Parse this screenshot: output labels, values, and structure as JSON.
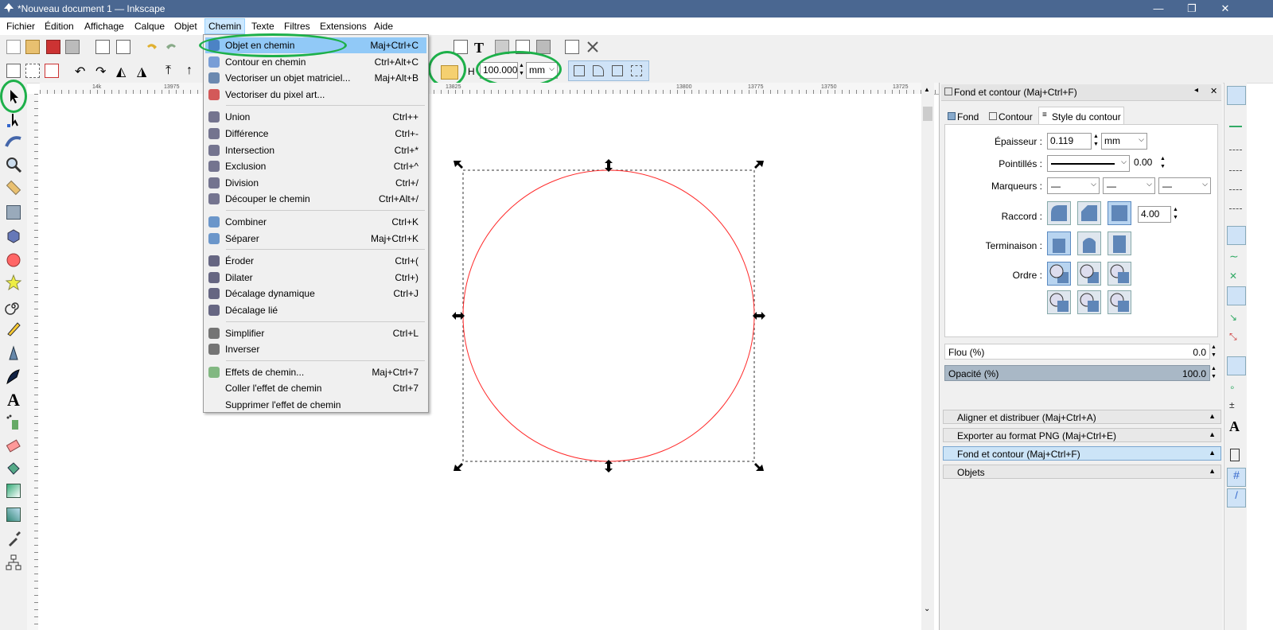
{
  "window": {
    "title": "*Nouveau document 1 — Inkscape",
    "min": "—",
    "max": "❐",
    "close": "✕"
  },
  "menubar": [
    {
      "label": "Fichier"
    },
    {
      "label": "Édition"
    },
    {
      "label": "Affichage"
    },
    {
      "label": "Calque"
    },
    {
      "label": "Objet"
    },
    {
      "label": "Chemin"
    },
    {
      "label": "Texte"
    },
    {
      "label": "Filtres"
    },
    {
      "label": "Extensions"
    },
    {
      "label": "Aide"
    }
  ],
  "toolbar2": {
    "h_label": "H",
    "h_value": "100.000",
    "unit": "mm"
  },
  "ruler": {
    "ticks": [
      "14k",
      "13975",
      "13825",
      "13800",
      "13775",
      "13750",
      "13725"
    ]
  },
  "menu_chemin": {
    "groups": [
      [
        {
          "label": "Objet en chemin",
          "shortcut": "Maj+Ctrl+C",
          "icon": "object-to-path-icon"
        },
        {
          "label": "Contour en chemin",
          "shortcut": "Ctrl+Alt+C",
          "icon": "stroke-to-path-icon"
        },
        {
          "label": "Vectoriser un objet matriciel...",
          "shortcut": "Maj+Alt+B",
          "icon": "trace-bitmap-icon"
        },
        {
          "label": "Vectoriser du pixel art...",
          "shortcut": "",
          "icon": "trace-pixel-art-icon"
        }
      ],
      [
        {
          "label": "Union",
          "shortcut": "Ctrl++",
          "icon": "union-icon"
        },
        {
          "label": "Différence",
          "shortcut": "Ctrl+-",
          "icon": "difference-icon"
        },
        {
          "label": "Intersection",
          "shortcut": "Ctrl+*",
          "icon": "intersection-icon"
        },
        {
          "label": "Exclusion",
          "shortcut": "Ctrl+^",
          "icon": "exclusion-icon"
        },
        {
          "label": "Division",
          "shortcut": "Ctrl+/",
          "icon": "division-icon"
        },
        {
          "label": "Découper le chemin",
          "shortcut": "Ctrl+Alt+/",
          "icon": "cut-path-icon"
        }
      ],
      [
        {
          "label": "Combiner",
          "shortcut": "Ctrl+K",
          "icon": "combine-icon"
        },
        {
          "label": "Séparer",
          "shortcut": "Maj+Ctrl+K",
          "icon": "break-apart-icon"
        }
      ],
      [
        {
          "label": "Éroder",
          "shortcut": "Ctrl+(",
          "icon": "inset-icon"
        },
        {
          "label": "Dilater",
          "shortcut": "Ctrl+)",
          "icon": "outset-icon"
        },
        {
          "label": "Décalage dynamique",
          "shortcut": "Ctrl+J",
          "icon": "dynamic-offset-icon"
        },
        {
          "label": "Décalage lié",
          "shortcut": "",
          "icon": "linked-offset-icon"
        }
      ],
      [
        {
          "label": "Simplifier",
          "shortcut": "Ctrl+L",
          "icon": "simplify-icon"
        },
        {
          "label": "Inverser",
          "shortcut": "",
          "icon": "reverse-icon"
        }
      ],
      [
        {
          "label": "Effets de chemin...",
          "shortcut": "Maj+Ctrl+7",
          "icon": "path-effects-icon"
        },
        {
          "label": "Coller l'effet de chemin",
          "shortcut": "Ctrl+7",
          "icon": ""
        },
        {
          "label": "Supprimer l'effet de chemin",
          "shortcut": "",
          "icon": ""
        }
      ]
    ]
  },
  "panel": {
    "title": "Fond et contour (Maj+Ctrl+F)",
    "tabs": [
      {
        "label": "Fond"
      },
      {
        "label": "Contour"
      },
      {
        "label": "Style du contour"
      }
    ],
    "epaisseur_label": "Épaisseur :",
    "epaisseur_value": "0.119",
    "epaisseur_unit": "mm",
    "pointilles_label": "Pointillés :",
    "pointilles_value": "0.00",
    "marqueurs_label": "Marqueurs :",
    "raccord_label": "Raccord :",
    "raccord_value": "4.00",
    "terminaison_label": "Terminaison :",
    "ordre_label": "Ordre :",
    "flou_label": "Flou (%)",
    "flou_value": "0.0",
    "opacite_label": "Opacité (%)",
    "opacite_value": "100.0",
    "docks": [
      {
        "label": "Aligner et distribuer (Maj+Ctrl+A)"
      },
      {
        "label": "Exporter au format PNG (Maj+Ctrl+E)"
      },
      {
        "label": "Fond et contour (Maj+Ctrl+F)"
      },
      {
        "label": "Objets"
      }
    ]
  },
  "colors": {
    "circle_stroke": "#ff2a2a",
    "accent": "#1db04a",
    "titlebar": "#4a6791"
  }
}
